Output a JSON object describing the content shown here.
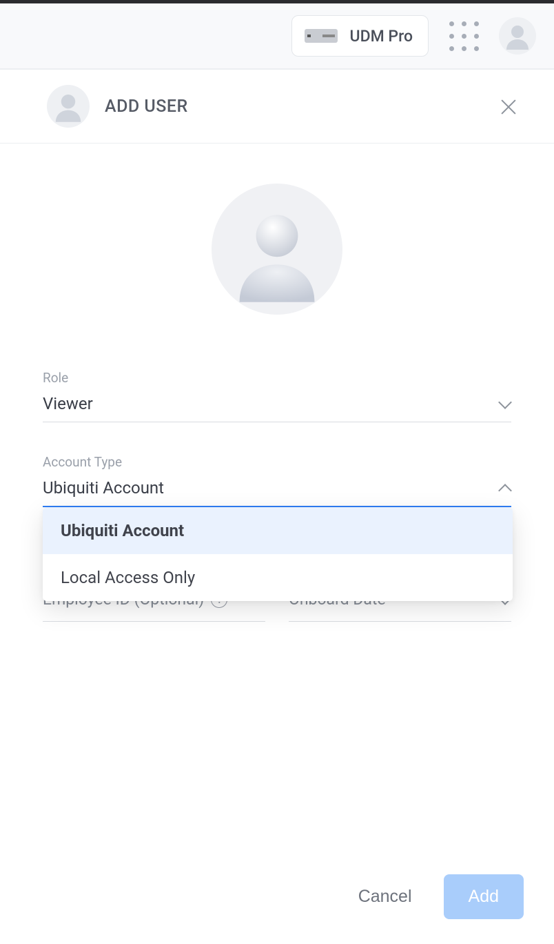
{
  "topbar": {
    "console_name": "UDM Pro"
  },
  "panel": {
    "title": "ADD USER"
  },
  "form": {
    "role_label": "Role",
    "role_value": "Viewer",
    "account_type_label": "Account Type",
    "account_type_value": "Ubiquiti Account",
    "account_type_options": [
      "Ubiquiti Account",
      "Local Access Only"
    ],
    "employee_id_label": "Employee ID (Optional)",
    "onboard_date_label": "Onboard Date"
  },
  "footer": {
    "cancel_label": "Cancel",
    "add_label": "Add"
  }
}
